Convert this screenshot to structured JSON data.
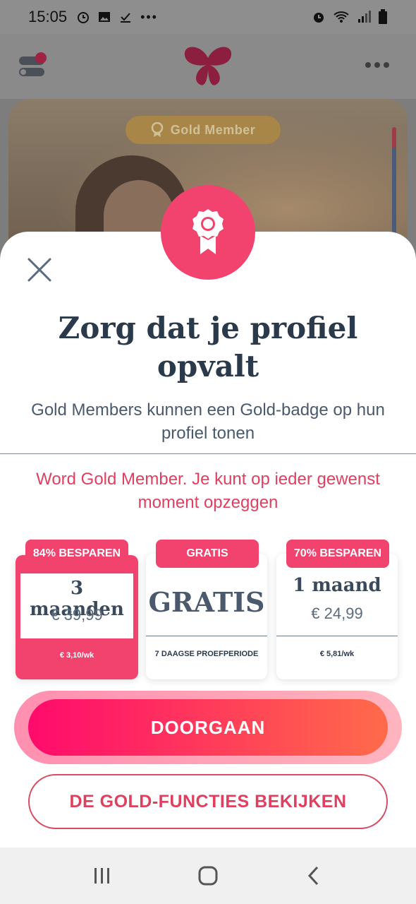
{
  "status_bar": {
    "time": "15:05",
    "left_icons": [
      "clock-icon",
      "image-icon",
      "download-icon",
      "more-icon"
    ],
    "right_icons": [
      "alarm-icon",
      "wifi-icon",
      "signal-icon",
      "battery-icon"
    ]
  },
  "background": {
    "badge_label": "Gold Member"
  },
  "sheet": {
    "headline": "Zorg dat je profiel opvalt",
    "subline": "Gold Members kunnen een Gold-badge op hun profiel tonen",
    "promo": "Word Gold Member. Je kunt op ieder gewenst moment opzeggen"
  },
  "plans": [
    {
      "tag": "84% BESPAREN",
      "name": "3 maanden",
      "price": "€ 39,99",
      "footer": "€ 3,10/wk",
      "selected": true
    },
    {
      "tag": "GRATIS",
      "name": "GRATIS",
      "price": "",
      "footer": "7 DAAGSE PROEFPERIODE",
      "selected": false
    },
    {
      "tag": "70% BESPAREN",
      "name": "1 maand",
      "price": "€ 24,99",
      "footer": "€ 5,81/wk",
      "selected": false
    }
  ],
  "buttons": {
    "continue": "DOORGAAN",
    "features": "DE GOLD-FUNCTIES BEKIJKEN"
  },
  "colors": {
    "accent": "#f2436f",
    "text_dark": "#2b3a4b",
    "promo_text": "#e0405f"
  }
}
